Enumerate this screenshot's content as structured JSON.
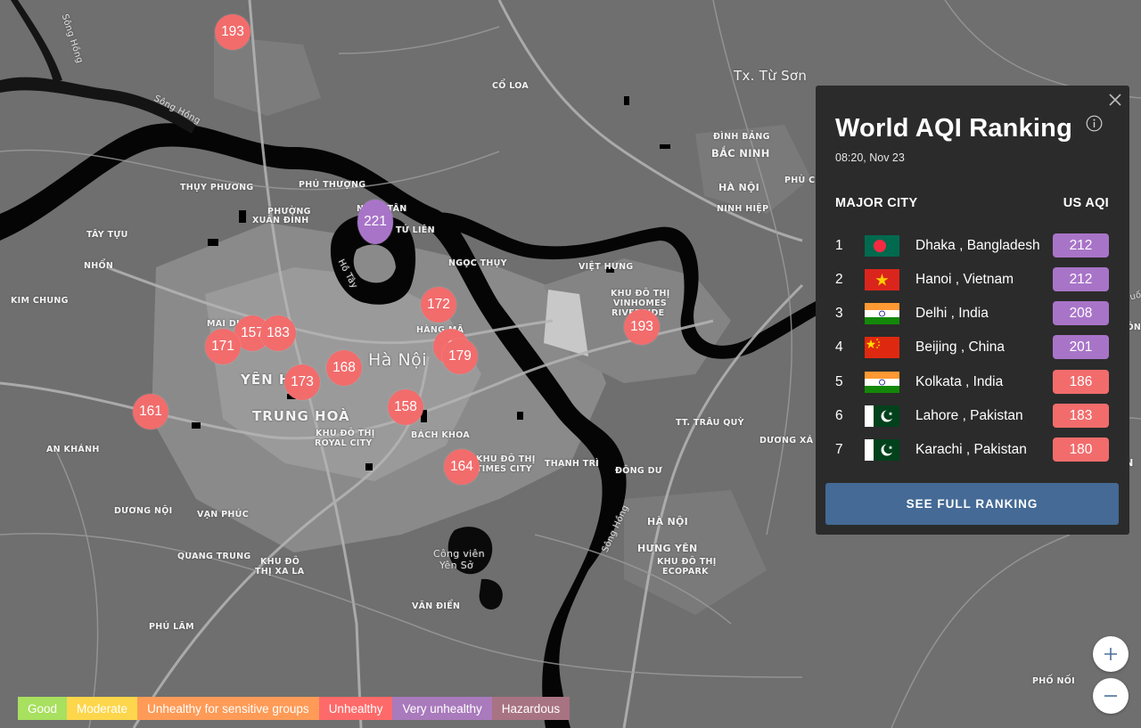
{
  "map": {
    "labels": {
      "tx_tu_son": "Tx. Từ Sơn",
      "co_loa": "CỔ LOA",
      "song_hong_nw": "Sông Hồng",
      "song_hong_w": "Sông Hồng",
      "dinh_bang": "ĐÌNH BẢNG",
      "bac_ninh": "BẮC NINH",
      "ha_noi_ne": "HÀ NỘI",
      "ninh_hiep": "NINH HIỆP",
      "phu_chan": "PHÙ CHẨN",
      "thuy_phuong": "THỤY PHƯƠNG",
      "phu_thuong": "PHÚ THƯỢNG",
      "phuong_xuan_dinh_1": "PHƯỜNG",
      "phuong_xuan_dinh_2": "XUÂN ĐỈNH",
      "nhat_tan": "NHẬT TÂN",
      "tu_lien": "TỨ LIÊN",
      "tay_tuu": "TÂY TỰU",
      "nhon": "NHỔN",
      "kim_chung": "KIM CHUNG",
      "ho_tay": "Hồ Tây",
      "ngoc_thuy": "NGỌC THỤY",
      "viet_hung": "VIỆT HƯNG",
      "vinhomes_1": "KHU ĐÔ THỊ",
      "vinhomes_2": "VINHOMES",
      "vinhomes_3": "RIVERSIDE",
      "song_duong": "Sông Đuống",
      "gia_dong": "GIA ĐÔNG",
      "mai_dich": "MAI DỊCH",
      "hang_ma": "HÀNG MÃ",
      "ha_noi_city": "Hà Nội",
      "yen_hoa": "YÊN HOÀ",
      "trung_hoa": "TRUNG HOÀ",
      "royal_1": "KHU ĐÔ THỊ",
      "royal_2": "ROYAL CITY",
      "bach_khoa": "BÁCH KHOA",
      "times_1": "KHU ĐÔ THỊ",
      "times_2": "TIMES CITY",
      "thanh_tri": "THANH TRÌ",
      "tt_trau_quy": "TT. TRÂU QUỲ",
      "duong_xa": "DƯƠNG XÁ",
      "dong_du": "ĐÔNG DƯ",
      "an_khanh": "AN KHÁNH",
      "duong_noi": "DƯƠNG NỘI",
      "van_phuc": "VẠN PHÚC",
      "quang_trung": "QUANG TRUNG",
      "xa_la_1": "KHU ĐÔ",
      "xa_la_2": "THỊ XA LA",
      "cong_vien_1": "Công viên",
      "cong_vien_2": "Yên Sở",
      "song_hong_s": "Sông Hồng",
      "ha_noi_se": "HÀ NỘI",
      "hung_yen": "HƯNG YÊN",
      "ecopark_1": "KHU ĐÔ THỊ",
      "ecopark_2": "ECOPARK",
      "van_dien": "VĂN ĐIỂN",
      "phu_lam": "PHÚ LÃM",
      "phu_noi": "PHỐ NỐI",
      "yen_edge": "YÊN"
    },
    "markers": [
      {
        "value": "193",
        "level": "unhealthy"
      },
      {
        "value": "221",
        "level": "very-unhealthy"
      },
      {
        "value": "172",
        "level": "unhealthy"
      },
      {
        "value": "193",
        "level": "unhealthy"
      },
      {
        "value": "157",
        "level": "unhealthy"
      },
      {
        "value": "183",
        "level": "unhealthy"
      },
      {
        "value": "171",
        "level": "unhealthy"
      },
      {
        "value": "1",
        "level": "unhealthy"
      },
      {
        "value": "179",
        "level": "unhealthy"
      },
      {
        "value": "168",
        "level": "unhealthy"
      },
      {
        "value": "173",
        "level": "unhealthy"
      },
      {
        "value": "158",
        "level": "unhealthy"
      },
      {
        "value": "161",
        "level": "unhealthy"
      },
      {
        "value": "164",
        "level": "unhealthy"
      }
    ]
  },
  "panel": {
    "title": "World AQI Ranking",
    "timestamp": "08:20, Nov 23",
    "col_city": "MAJOR CITY",
    "col_aqi": "US AQI",
    "rows": [
      {
        "rank": "1",
        "city": "Dhaka , Bangladesh",
        "aqi": "212",
        "level": "very-unhealthy",
        "flag": "bangladesh"
      },
      {
        "rank": "2",
        "city": "Hanoi , Vietnam",
        "aqi": "212",
        "level": "very-unhealthy",
        "flag": "vietnam"
      },
      {
        "rank": "3",
        "city": "Delhi , India",
        "aqi": "208",
        "level": "very-unhealthy",
        "flag": "india"
      },
      {
        "rank": "4",
        "city": "Beijing , China",
        "aqi": "201",
        "level": "very-unhealthy",
        "flag": "china"
      },
      {
        "rank": "5",
        "city": "Kolkata , India",
        "aqi": "186",
        "level": "unhealthy",
        "flag": "india"
      },
      {
        "rank": "6",
        "city": "Lahore , Pakistan",
        "aqi": "183",
        "level": "unhealthy",
        "flag": "pakistan"
      },
      {
        "rank": "7",
        "city": "Karachi , Pakistan",
        "aqi": "180",
        "level": "unhealthy",
        "flag": "pakistan"
      }
    ],
    "button": "SEE FULL RANKING"
  },
  "zoom": {
    "in": "+",
    "out": "−"
  },
  "legend": [
    {
      "label": "Good",
      "color": "#a8e05f"
    },
    {
      "label": "Moderate",
      "color": "#fdd64b"
    },
    {
      "label": "Unhealthy for sensitive groups",
      "color": "#ff9b57"
    },
    {
      "label": "Unhealthy",
      "color": "#fe6a69"
    },
    {
      "label": "Very unhealthy",
      "color": "#a97abc"
    },
    {
      "label": "Hazardous",
      "color": "#a87383"
    }
  ],
  "colors": {
    "unhealthy": "#f26c6c",
    "very_unhealthy": "#a874c8",
    "panel_bg": "#2b2b2b",
    "button_bg": "#446a95"
  }
}
